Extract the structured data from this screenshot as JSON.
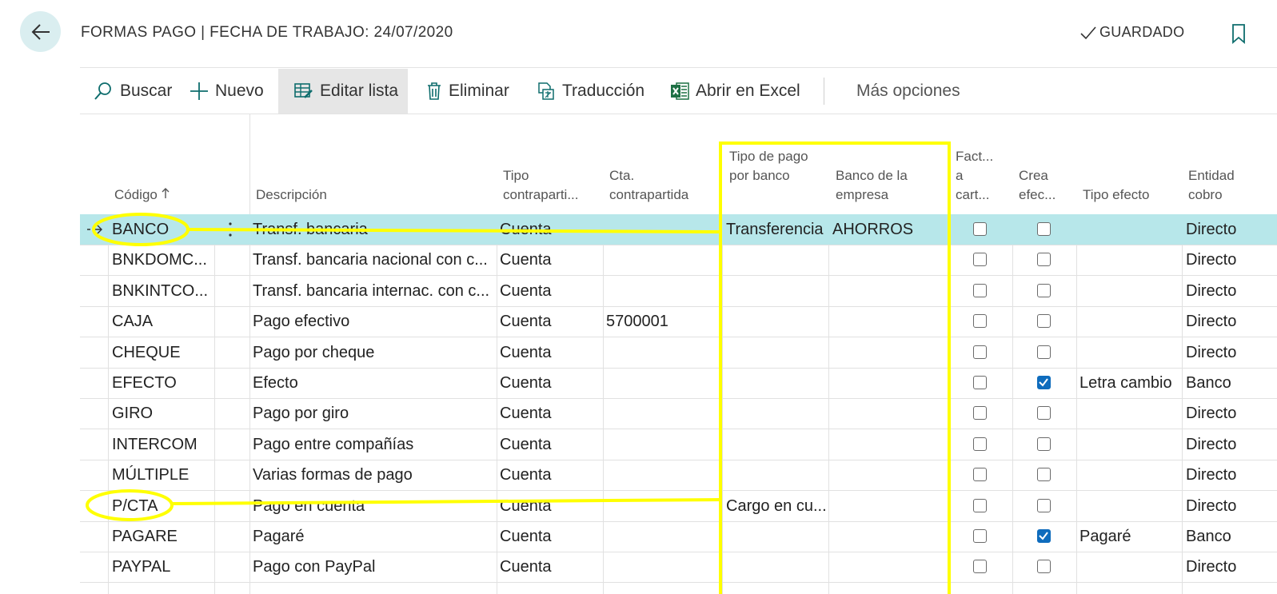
{
  "header": {
    "title": "FORMAS PAGO | FECHA DE TRABAJO: 24/07/2020",
    "saved_label": "GUARDADO"
  },
  "toolbar": {
    "search": "Buscar",
    "new": "Nuevo",
    "edit_list": "Editar lista",
    "delete": "Eliminar",
    "translation": "Traducción",
    "open_excel": "Abrir en Excel",
    "more": "Más opciones"
  },
  "columns": {
    "codigo": "Código",
    "descripcion": "Descripción",
    "tipo_contra": "Tipo contraparti...",
    "cta_contra": "Cta. contrapartida",
    "tipo_pago_banco": "Tipo de pago por banco",
    "banco_empresa": "Banco de la empresa",
    "fact_cartera": "Fact... a cart...",
    "crea_efectos": "Crea efec...",
    "tipo_efecto": "Tipo efecto",
    "entidad_cobro": "Entidad cobro"
  },
  "rows": [
    {
      "codigo": "BANCO",
      "descripcion": "Transf. bancaria",
      "tipo": "Cuenta",
      "cta": "",
      "tipo_pago": "Transferencia",
      "banco": "AHORROS",
      "fact": false,
      "crea": false,
      "tipo_efecto": "",
      "entidad": "Directo",
      "selected": true
    },
    {
      "codigo": "BNKDOMC...",
      "descripcion": "Transf. bancaria nacional con c...",
      "tipo": "Cuenta",
      "cta": "",
      "tipo_pago": "",
      "banco": "",
      "fact": false,
      "crea": false,
      "tipo_efecto": "",
      "entidad": "Directo"
    },
    {
      "codigo": "BNKINTCO...",
      "descripcion": "Transf. bancaria internac. con c...",
      "tipo": "Cuenta",
      "cta": "",
      "tipo_pago": "",
      "banco": "",
      "fact": false,
      "crea": false,
      "tipo_efecto": "",
      "entidad": "Directo"
    },
    {
      "codigo": "CAJA",
      "descripcion": "Pago efectivo",
      "tipo": "Cuenta",
      "cta": "5700001",
      "tipo_pago": "",
      "banco": "",
      "fact": false,
      "crea": false,
      "tipo_efecto": "",
      "entidad": "Directo"
    },
    {
      "codigo": "CHEQUE",
      "descripcion": "Pago por cheque",
      "tipo": "Cuenta",
      "cta": "",
      "tipo_pago": "",
      "banco": "",
      "fact": false,
      "crea": false,
      "tipo_efecto": "",
      "entidad": "Directo"
    },
    {
      "codigo": "EFECTO",
      "descripcion": "Efecto",
      "tipo": "Cuenta",
      "cta": "",
      "tipo_pago": "",
      "banco": "",
      "fact": false,
      "crea": true,
      "tipo_efecto": "Letra cambio",
      "entidad": "Banco"
    },
    {
      "codigo": "GIRO",
      "descripcion": "Pago por giro",
      "tipo": "Cuenta",
      "cta": "",
      "tipo_pago": "",
      "banco": "",
      "fact": false,
      "crea": false,
      "tipo_efecto": "",
      "entidad": "Directo"
    },
    {
      "codigo": "INTERCOM",
      "descripcion": "Pago entre compañías",
      "tipo": "Cuenta",
      "cta": "",
      "tipo_pago": "",
      "banco": "",
      "fact": false,
      "crea": false,
      "tipo_efecto": "",
      "entidad": "Directo"
    },
    {
      "codigo": "MÚLTIPLE",
      "descripcion": "Varias formas de pago",
      "tipo": "Cuenta",
      "cta": "",
      "tipo_pago": "",
      "banco": "",
      "fact": false,
      "crea": false,
      "tipo_efecto": "",
      "entidad": "Directo"
    },
    {
      "codigo": "P/CTA",
      "descripcion": "Pago en cuenta",
      "tipo": "Cuenta",
      "cta": "",
      "tipo_pago": "Cargo en cu...",
      "banco": "",
      "fact": false,
      "crea": false,
      "tipo_efecto": "",
      "entidad": "Directo"
    },
    {
      "codigo": "PAGARE",
      "descripcion": "Pagaré",
      "tipo": "Cuenta",
      "cta": "",
      "tipo_pago": "",
      "banco": "",
      "fact": false,
      "crea": true,
      "tipo_efecto": "Pagaré",
      "entidad": "Banco"
    },
    {
      "codigo": "PAYPAL",
      "descripcion": "Pago con PayPal",
      "tipo": "Cuenta",
      "cta": "",
      "tipo_pago": "",
      "banco": "",
      "fact": false,
      "crea": false,
      "tipo_efecto": "",
      "entidad": "Directo"
    }
  ],
  "icons": {
    "back": "arrow-left-icon",
    "saved": "checkmark-icon",
    "bookmark": "bookmark-icon",
    "search": "search-icon",
    "new": "plus-icon",
    "edit_list": "edit-list-icon",
    "delete": "trash-icon",
    "translation": "translate-icon",
    "excel": "excel-icon",
    "sort": "sort-ascending-icon",
    "row_marker": "current-row-arrow-icon",
    "row_actions": "more-vertical-icon"
  },
  "colors": {
    "accent": "#0f6cbd",
    "back_button_bg": "#daeef0",
    "selected_row": "#b7e7ea",
    "annotation": "#ffff00",
    "excel_green": "#1d7044",
    "teal_icon": "#0e6d6d"
  }
}
